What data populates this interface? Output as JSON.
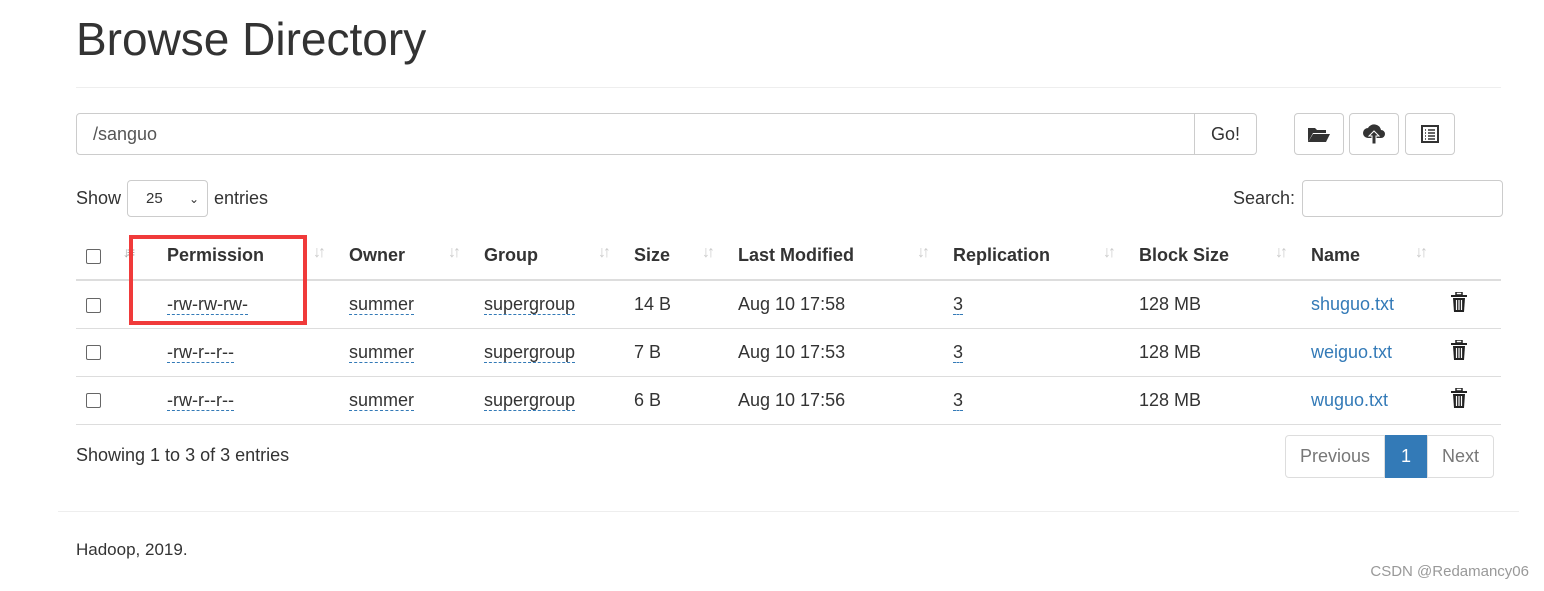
{
  "title": "Browse Directory",
  "path": {
    "value": "/sanguo",
    "go_label": "Go!"
  },
  "toolbar": {
    "icons": [
      "folder-open-icon",
      "cloud-upload-icon",
      "list-icon"
    ]
  },
  "length": {
    "show": "Show",
    "value": "25",
    "entries": "entries"
  },
  "search": {
    "label": "Search:",
    "value": ""
  },
  "columns": [
    "Permission",
    "Owner",
    "Group",
    "Size",
    "Last Modified",
    "Replication",
    "Block Size",
    "Name"
  ],
  "rows": [
    {
      "permission": "-rw-rw-rw-",
      "owner": "summer",
      "group": "supergroup",
      "size": "14 B",
      "modified": "Aug 10 17:58",
      "replication": "3",
      "block_size": "128 MB",
      "name": "shuguo.txt"
    },
    {
      "permission": "-rw-r--r--",
      "owner": "summer",
      "group": "supergroup",
      "size": "7 B",
      "modified": "Aug 10 17:53",
      "replication": "3",
      "block_size": "128 MB",
      "name": "weiguo.txt"
    },
    {
      "permission": "-rw-r--r--",
      "owner": "summer",
      "group": "supergroup",
      "size": "6 B",
      "modified": "Aug 10 17:56",
      "replication": "3",
      "block_size": "128 MB",
      "name": "wuguo.txt"
    }
  ],
  "info": "Showing 1 to 3 of 3 entries",
  "pagination": {
    "previous": "Previous",
    "current": "1",
    "next": "Next"
  },
  "footer": "Hadoop, 2019.",
  "watermark": "CSDN @Redamancy06",
  "colors": {
    "link": "#337ab7",
    "highlight_box": "#f03a3a"
  }
}
